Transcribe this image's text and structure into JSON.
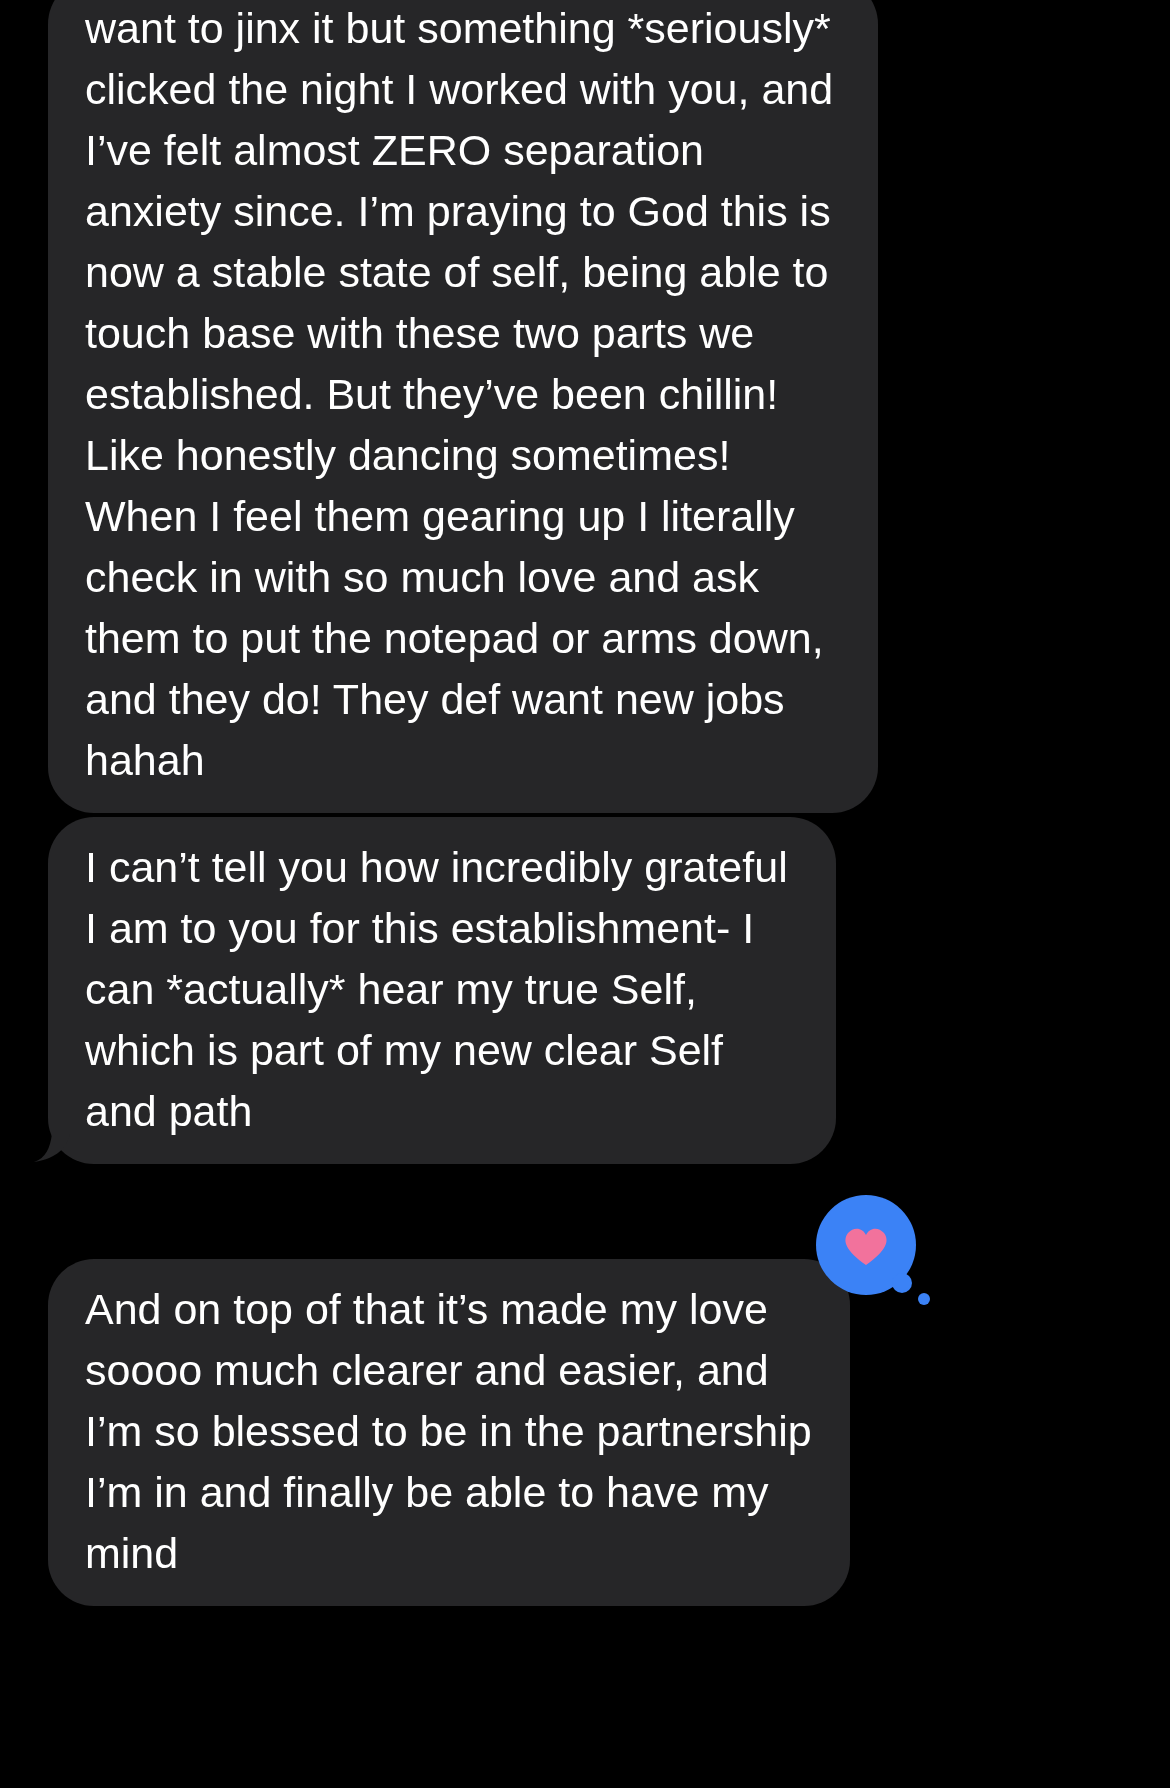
{
  "messages": [
    {
      "text": "want to jinx it but something *seriously* clicked the night I worked with you, and I’ve felt almost ZERO separation anxiety since. I’m praying to God this is now a stable state of self, being able to touch base with these two parts we established. But they’ve been chillin! Like honestly dancing sometimes! When I feel them gearing up I literally check in with so much love and ask them to put the notepad or arms down, and they do! They def want new jobs hahah",
      "tail": false
    },
    {
      "text": "I can’t tell you how incredibly grateful I am to you for this establishment- I can *actually* hear my true Self, which is part of my new clear Self and path",
      "tail": true
    },
    {
      "text": "And on top of that it’s made my love soooo much clearer and easier, and I’m so blessed to be in the partnership I’m in and finally be able to have my mind",
      "tail": false,
      "reaction": {
        "kind": "heart"
      }
    }
  ]
}
